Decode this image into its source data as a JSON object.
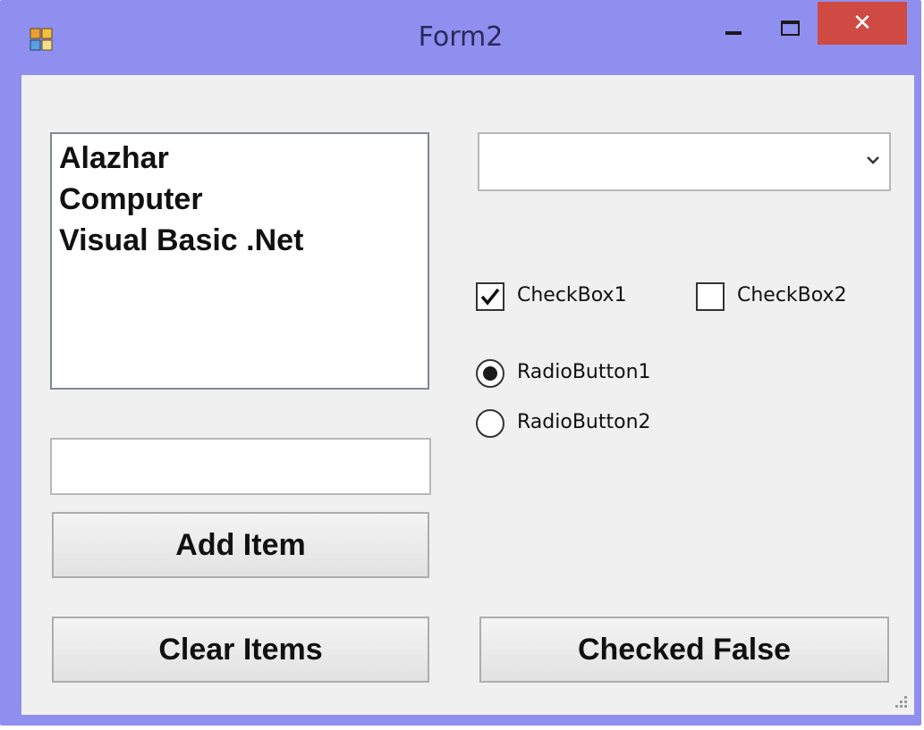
{
  "window": {
    "title": "Form2",
    "close_glyph": "✕",
    "controls": [
      "minimize-icon",
      "maximize-icon",
      "close-icon"
    ],
    "colors": {
      "frame": "#8f8ff0",
      "close": "#cf4a43",
      "client": "#f0f0f0"
    }
  },
  "listbox": {
    "items": [
      "Alazhar",
      "Computer",
      "Visual Basic .Net"
    ]
  },
  "combobox": {
    "value": ""
  },
  "textbox": {
    "value": ""
  },
  "buttons": {
    "add": "Add Item",
    "clear": "Clear Items",
    "checked_false": "Checked False"
  },
  "checkboxes": [
    {
      "label": "CheckBox1",
      "checked": true
    },
    {
      "label": "CheckBox2",
      "checked": false
    }
  ],
  "radios": [
    {
      "label": "RadioButton1",
      "selected": true
    },
    {
      "label": "RadioButton2",
      "selected": false
    }
  ]
}
